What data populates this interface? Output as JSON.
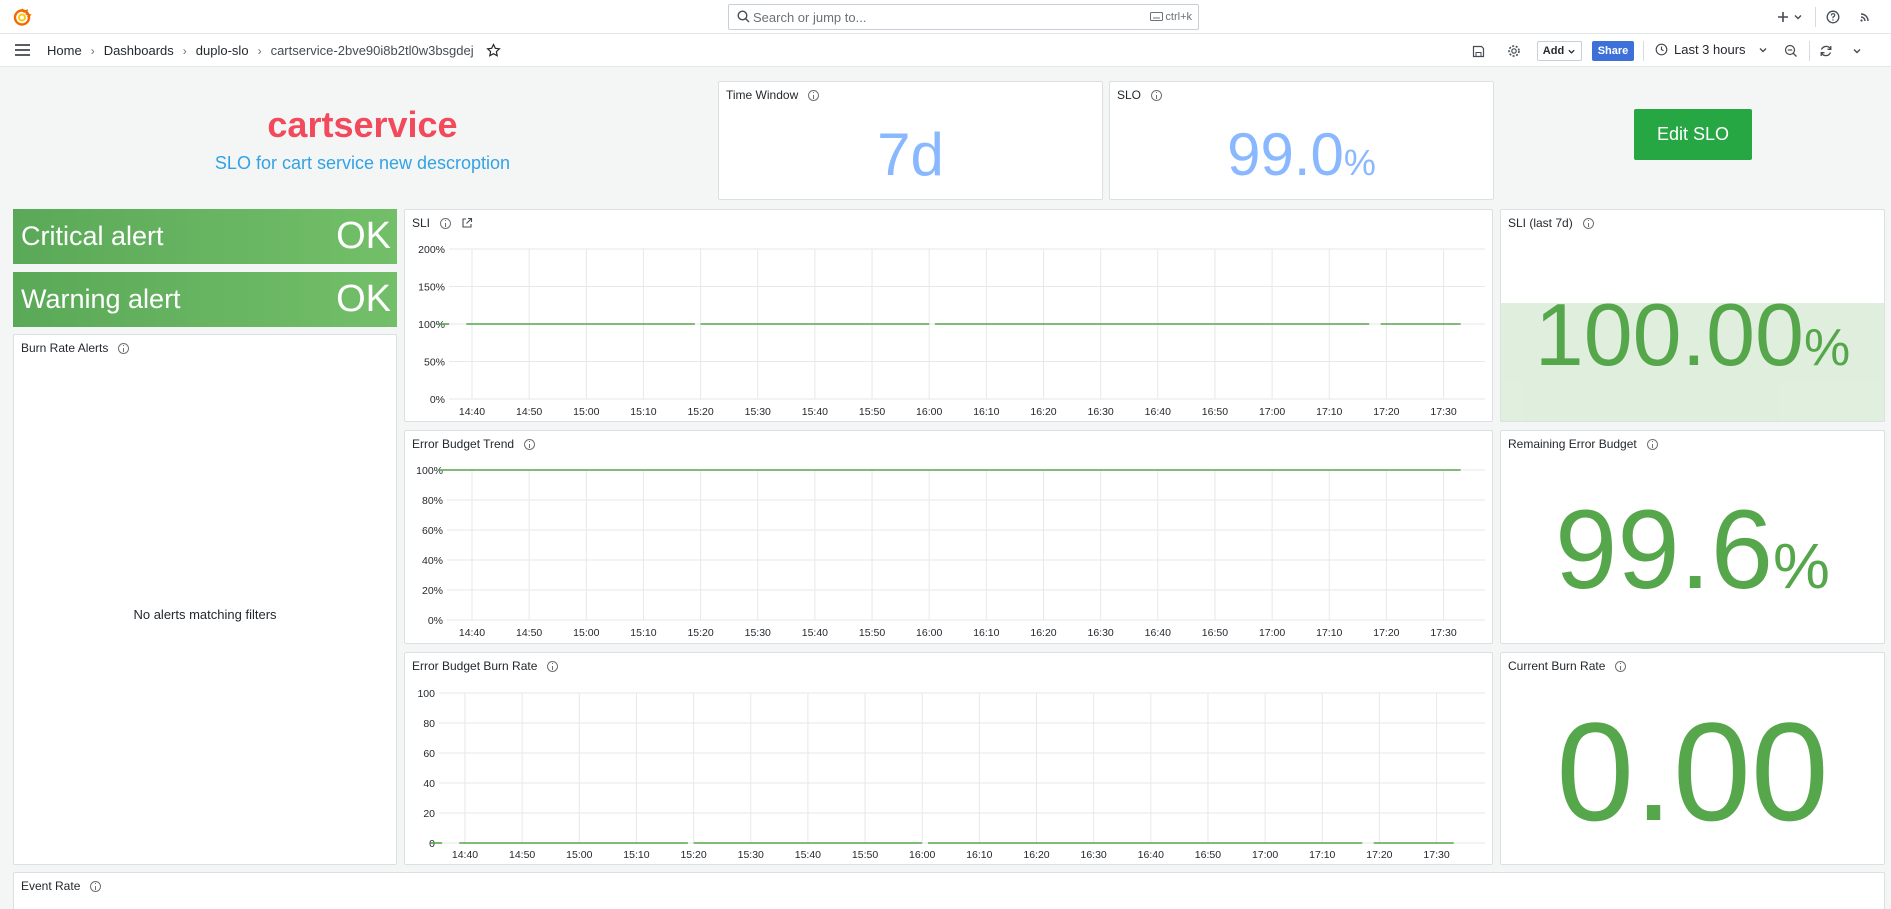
{
  "topbar": {
    "search_placeholder": "Search or jump to...",
    "search_shortcut": "ctrl+k"
  },
  "breadcrumb": [
    "Home",
    "Dashboards",
    "duplo-slo",
    "cartservice-2bve90i8b2tl0w3bsgdej"
  ],
  "toolbar": {
    "add_label": "Add",
    "share_label": "Share",
    "time_range": "Last 3 hours"
  },
  "header": {
    "title": "cartservice",
    "subtitle": "SLO for cart service new descroption",
    "edit_label": "Edit SLO"
  },
  "stats": {
    "time_window": {
      "title": "Time Window",
      "value": "7d"
    },
    "slo": {
      "title": "SLO",
      "value": "99.0",
      "unit": "%"
    },
    "sli_last": {
      "title": "SLI (last 7d)",
      "value": "100.00",
      "unit": "%",
      "level": 0.56
    },
    "remaining": {
      "title": "Remaining Error Budget",
      "value": "99.6",
      "unit": "%"
    },
    "burn": {
      "title": "Current Burn Rate",
      "value": "0.00"
    }
  },
  "alerts": {
    "critical": {
      "label": "Critical alert",
      "value": "OK"
    },
    "warning": {
      "label": "Warning alert",
      "value": "OK"
    },
    "panel_title": "Burn Rate Alerts",
    "empty_text": "No alerts matching filters"
  },
  "event_rate": {
    "title": "Event Rate"
  },
  "colors": {
    "green": "#56a64b",
    "blue_stat": "#8ab8ff",
    "red_title": "#f2495c",
    "subtitle": "#33a2e5",
    "share": "#3d71d9",
    "edit_button": "#26a744"
  },
  "chart_data": [
    {
      "type": "line",
      "title": "SLI",
      "x_ticks": [
        "14:40",
        "14:50",
        "15:00",
        "15:10",
        "15:20",
        "15:30",
        "15:40",
        "15:50",
        "16:00",
        "16:10",
        "16:20",
        "16:30",
        "16:40",
        "16:50",
        "17:00",
        "17:10",
        "17:20",
        "17:30"
      ],
      "y_ticks": [
        "0%",
        "50%",
        "100%",
        "150%",
        "200%"
      ],
      "ylim": [
        0,
        200
      ],
      "segments": [
        [
          "14:34",
          "14:36"
        ],
        [
          "14:39",
          "15:19"
        ],
        [
          "15:20",
          "16:00"
        ],
        [
          "16:01",
          "17:17"
        ],
        [
          "17:19",
          "17:33"
        ]
      ],
      "value": 100
    },
    {
      "type": "line",
      "title": "Error Budget Trend",
      "x_ticks": [
        "14:40",
        "14:50",
        "15:00",
        "15:10",
        "15:20",
        "15:30",
        "15:40",
        "15:50",
        "16:00",
        "16:10",
        "16:20",
        "16:30",
        "16:40",
        "16:50",
        "17:00",
        "17:10",
        "17:20",
        "17:30"
      ],
      "y_ticks": [
        "0%",
        "20%",
        "40%",
        "60%",
        "80%",
        "100%"
      ],
      "ylim": [
        0,
        100
      ],
      "segments": [
        [
          "14:34",
          "17:33"
        ]
      ],
      "value": 100
    },
    {
      "type": "line",
      "title": "Error Budget Burn Rate",
      "x_ticks": [
        "14:40",
        "14:50",
        "15:00",
        "15:10",
        "15:20",
        "15:30",
        "15:40",
        "15:50",
        "16:00",
        "16:10",
        "16:20",
        "16:30",
        "16:40",
        "16:50",
        "17:00",
        "17:10",
        "17:20",
        "17:30"
      ],
      "y_ticks": [
        "0",
        "20",
        "40",
        "60",
        "80",
        "100"
      ],
      "ylim": [
        0,
        100
      ],
      "segments": [
        [
          "14:34",
          "14:36"
        ],
        [
          "14:39",
          "15:19"
        ],
        [
          "15:20",
          "16:00"
        ],
        [
          "16:01",
          "17:17"
        ],
        [
          "17:19",
          "17:33"
        ]
      ],
      "value": 0
    }
  ]
}
